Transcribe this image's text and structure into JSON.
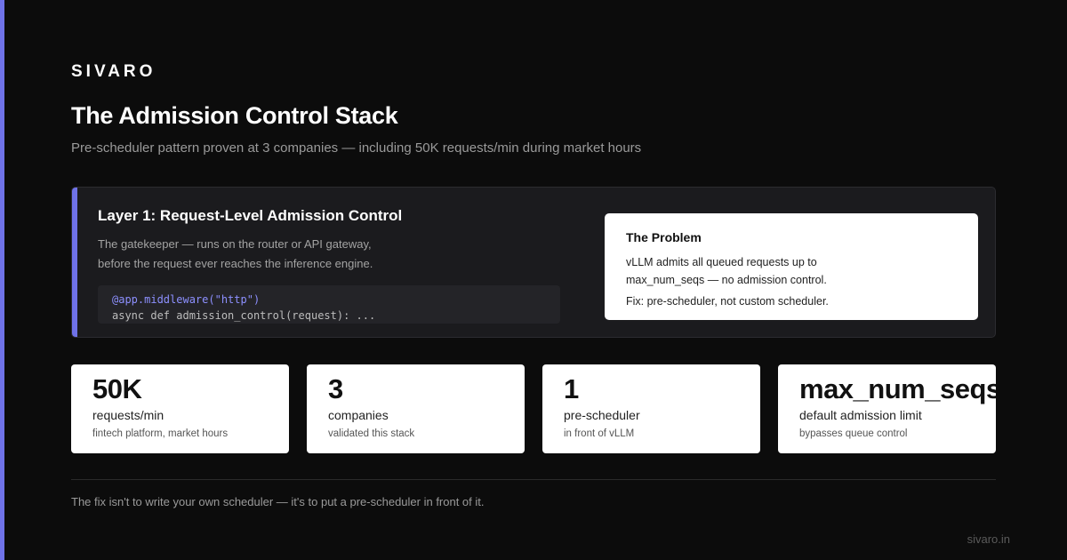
{
  "brand": "SIVARO",
  "title": "The Admission Control Stack",
  "subtitle": "Pre-scheduler pattern proven at 3 companies — including 50K requests/min during market hours",
  "layer": {
    "title": "Layer 1: Request-Level Admission Control",
    "desc_line1": "The gatekeeper — runs on the router or API gateway,",
    "desc_line2": "before the request ever reaches the inference engine.",
    "code_line1": "@app.middleware(\"http\")",
    "code_line2": "async def admission_control(request): ..."
  },
  "problem": {
    "title": "The Problem",
    "line1": "vLLM admits all queued requests up to",
    "line2": "max_num_seqs — no admission control.",
    "fix": "Fix: pre-scheduler, not custom scheduler."
  },
  "stats": [
    {
      "value": "50K",
      "label": "requests/min",
      "note": "fintech platform, market hours"
    },
    {
      "value": "3",
      "label": "companies",
      "note": "validated this stack"
    },
    {
      "value": "1",
      "label": "pre-scheduler",
      "note": "in front of vLLM"
    },
    {
      "value": "max_num_seqs",
      "label": "default admission limit",
      "note": "bypasses queue control"
    }
  ],
  "footer": {
    "text": "The fix isn't to write your own scheduler — it's to put a pre-scheduler in front of it.",
    "url": "sivaro.in"
  },
  "colors": {
    "accent": "#6f72e8",
    "background": "#0c0c0c",
    "panel": "#1b1b1e",
    "card": "#ffffff"
  }
}
